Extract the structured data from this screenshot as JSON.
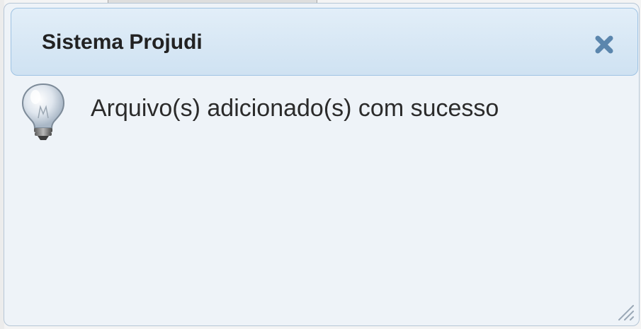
{
  "dialog": {
    "title": "Sistema Projudi",
    "message": "Arquivo(s) adicionado(s) com sucesso",
    "message_icon": "lightbulb-icon",
    "close_icon": "close-icon",
    "resize_icon": "resize-grip-icon"
  },
  "colors": {
    "titlebar_bg": "#d6e6f4",
    "titlebar_border": "#9fc3e3",
    "close_icon": "#5b86ad",
    "dialog_bg": "#eef3f8"
  }
}
